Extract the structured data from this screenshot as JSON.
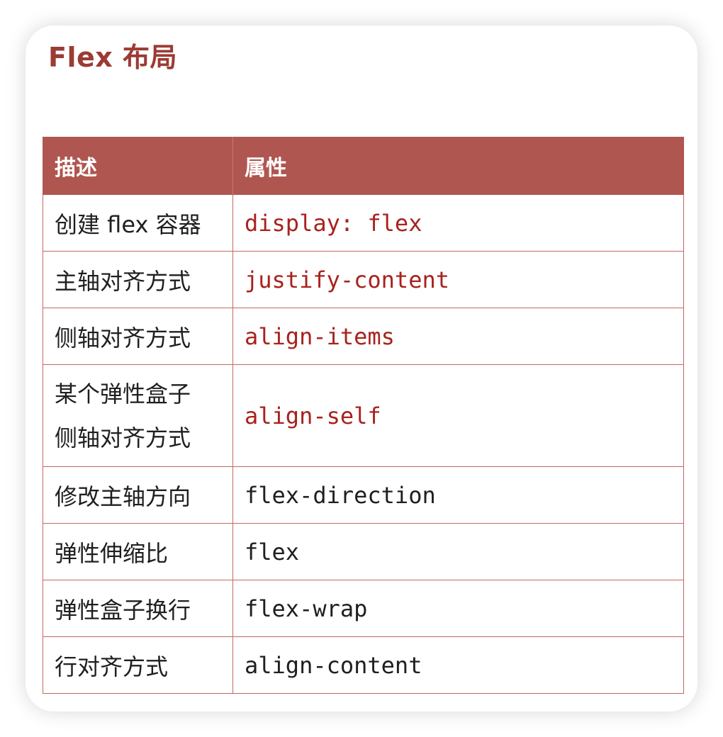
{
  "title": "Flex 布局",
  "table": {
    "headers": [
      "描述",
      "属性"
    ],
    "rows": [
      {
        "description": [
          "创建 flex 容器"
        ],
        "property": "display: flex",
        "highlighted": true
      },
      {
        "description": [
          "主轴对齐方式"
        ],
        "property": "justify-content",
        "highlighted": true
      },
      {
        "description": [
          "侧轴对齐方式"
        ],
        "property": "align-items",
        "highlighted": true
      },
      {
        "description": [
          "某个弹性盒子",
          "侧轴对齐方式"
        ],
        "property": "align-self",
        "highlighted": true
      },
      {
        "description": [
          "修改主轴方向"
        ],
        "property": "flex-direction",
        "highlighted": false
      },
      {
        "description": [
          "弹性伸缩比"
        ],
        "property": "flex",
        "highlighted": false
      },
      {
        "description": [
          "弹性盒子换行"
        ],
        "property": "flex-wrap",
        "highlighted": false
      },
      {
        "description": [
          "行对齐方式"
        ],
        "property": "align-content",
        "highlighted": false
      }
    ]
  },
  "colors": {
    "title": "#9b3b34",
    "header_background": "#b05650",
    "highlighted_code": "#a8221d",
    "plain_code": "#1f1f1f",
    "border": "#c26863"
  }
}
